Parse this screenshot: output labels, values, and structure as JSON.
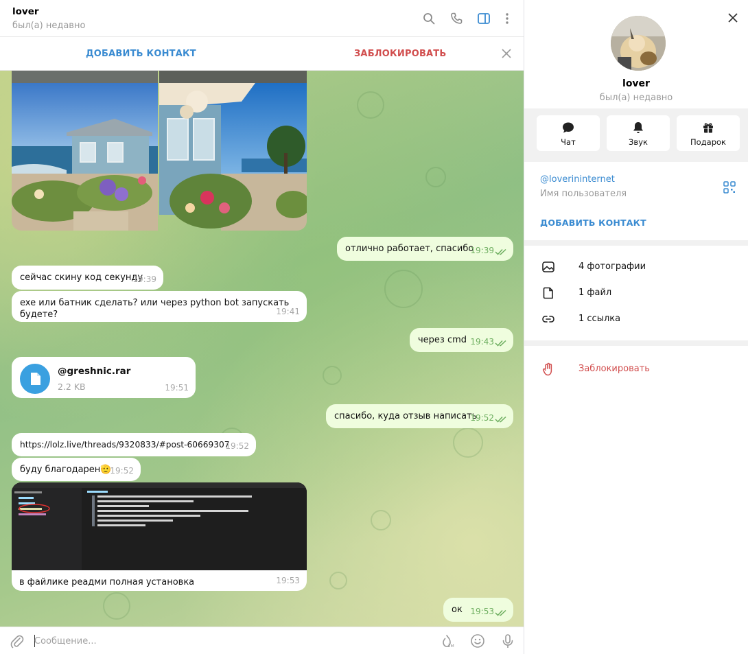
{
  "chat": {
    "header": {
      "name": "lover",
      "status": "был(а) недавно"
    },
    "actions": {
      "add_contact": "ДОБАВИТЬ КОНТАКТ",
      "block": "ЗАБЛОКИРОВАТЬ"
    },
    "messages": [
      {
        "dir": "out",
        "text": "отлично работает, спасибо",
        "time": "19:39"
      },
      {
        "dir": "in",
        "text": "сейчас скину код секунду",
        "time": "19:39"
      },
      {
        "dir": "in",
        "text": "exe или батник сделать? или через python bot запускать будете?",
        "time": "19:41"
      },
      {
        "dir": "out",
        "text": "через cmd",
        "time": "19:43"
      },
      {
        "dir": "in",
        "file_name": "@greshnic.rar",
        "file_size": "2.2 KB",
        "time": "19:51"
      },
      {
        "dir": "out",
        "text": "спасибо, куда отзыв написать",
        "time": "19:52"
      },
      {
        "dir": "in",
        "text": "https://lolz.live/threads/9320833/#post-60669307",
        "time": "19:52"
      },
      {
        "dir": "in",
        "text": "буду благодарен🫡",
        "time": "19:52"
      },
      {
        "dir": "in",
        "text": "в файлике реадми полная установка",
        "time": "19:53"
      },
      {
        "dir": "out",
        "text": "ок",
        "time": "19:53"
      }
    ],
    "composer": {
      "placeholder": "Сообщение..."
    }
  },
  "profile": {
    "name": "lover",
    "status": "был(а) недавно",
    "actions": [
      "Чат",
      "Звук",
      "Подарок"
    ],
    "username": "@loverininternet",
    "username_label": "Имя пользователя",
    "add_contact": "ДОБАВИТЬ КОНТАКТ",
    "media": [
      {
        "icon": "photo-icon",
        "label": "4 фотографии"
      },
      {
        "icon": "file-icon",
        "label": "1 файл"
      },
      {
        "icon": "link-icon",
        "label": "1 ссылка"
      }
    ],
    "block": "Заблокировать"
  },
  "colors": {
    "accent": "#3a8bd1",
    "danger": "#d14e4e",
    "outgoing_bubble": "#effdde",
    "read_ticks": "#6dae5f"
  }
}
